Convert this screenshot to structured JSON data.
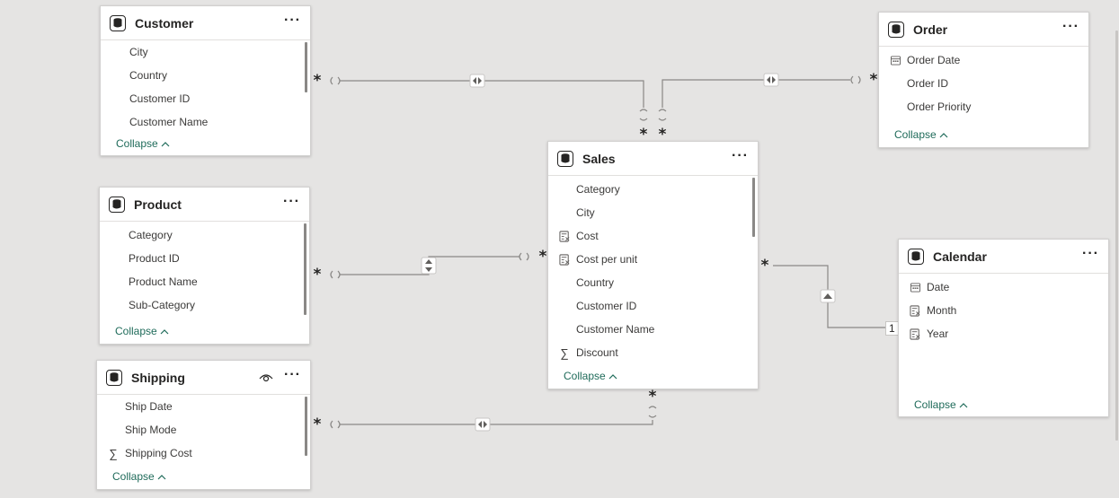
{
  "tables": {
    "customer": {
      "title": "Customer",
      "fields": [
        "City",
        "Country",
        "Customer ID",
        "Customer Name"
      ],
      "collapse": "Collapse"
    },
    "product": {
      "title": "Product",
      "fields": [
        "Category",
        "Product ID",
        "Product Name",
        "Sub-Category"
      ],
      "collapse": "Collapse"
    },
    "shipping": {
      "title": "Shipping",
      "fields": [
        "Ship Date",
        "Ship Mode",
        "Shipping Cost"
      ],
      "field_icons": [
        "",
        "",
        "sigma-icon"
      ],
      "collapse": "Collapse"
    },
    "sales": {
      "title": "Sales",
      "fields": [
        "Category",
        "City",
        "Cost",
        "Cost per unit",
        "Country",
        "Customer ID",
        "Customer Name",
        "Discount"
      ],
      "field_icons": [
        "",
        "",
        "calculated-column-icon",
        "calculated-column-icon",
        "",
        "",
        "",
        "sigma-icon"
      ],
      "collapse": "Collapse"
    },
    "order": {
      "title": "Order",
      "fields": [
        "Order Date",
        "Order ID",
        "Order Priority"
      ],
      "field_icons": [
        "calendar-icon",
        "",
        ""
      ],
      "collapse": "Collapse"
    },
    "calendar": {
      "title": "Calendar",
      "fields": [
        "Date",
        "Month",
        "Year"
      ],
      "field_icons": [
        "calendar-icon",
        "calculated-column-icon",
        "calculated-column-icon"
      ],
      "collapse": "Collapse"
    }
  },
  "cardinality": {
    "many": "*",
    "one": "1"
  },
  "relationships": [
    {
      "from": "Customer",
      "to": "Sales",
      "from_card": "*",
      "to_card": "*",
      "direction": "both"
    },
    {
      "from": "Order",
      "to": "Sales",
      "from_card": "*",
      "to_card": "*",
      "direction": "both"
    },
    {
      "from": "Product",
      "to": "Sales",
      "from_card": "*",
      "to_card": "*",
      "direction": "single"
    },
    {
      "from": "Shipping",
      "to": "Sales",
      "from_card": "*",
      "to_card": "*",
      "direction": "both"
    },
    {
      "from": "Calendar",
      "to": "Sales",
      "from_card": "1",
      "to_card": "*",
      "direction": "single"
    }
  ],
  "colors": {
    "canvas": "#e5e4e3",
    "link": "#1f6b5a",
    "line": "#8a8886"
  }
}
